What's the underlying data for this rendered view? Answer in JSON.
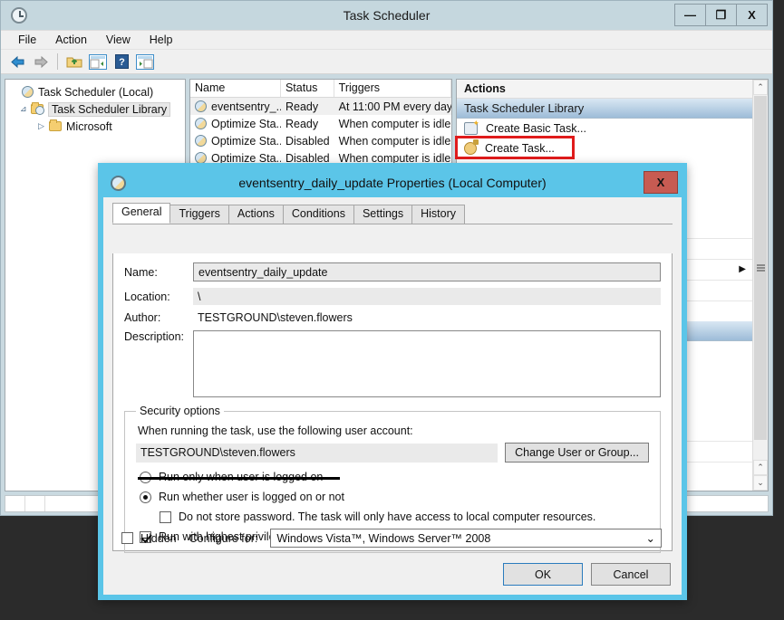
{
  "window": {
    "title": "Task Scheduler",
    "app_icon": "clock-icon",
    "controls": {
      "minimize": "—",
      "maximize": "❐",
      "close": "X"
    },
    "menu": [
      "File",
      "Action",
      "View",
      "Help"
    ],
    "toolbar": [
      {
        "name": "back-icon",
        "glyph": "⬅"
      },
      {
        "name": "forward-icon",
        "glyph": "➡"
      },
      {
        "name": "up-folder-icon",
        "glyph": "📂"
      },
      {
        "name": "show-tree-pane-icon",
        "glyph": "▤"
      },
      {
        "name": "help-icon",
        "glyph": "?"
      },
      {
        "name": "show-action-pane-icon",
        "glyph": "▥"
      }
    ]
  },
  "tree": {
    "root": "Task Scheduler (Local)",
    "library": "Task Scheduler Library",
    "microsoft": "Microsoft",
    "expander_open": "⊿",
    "expander_closed": "▷"
  },
  "tasklist": {
    "columns": [
      "Name",
      "Status",
      "Triggers"
    ],
    "rows": [
      {
        "name": "eventsentry_...",
        "status": "Ready",
        "triggers": "At 11:00 PM every day",
        "selected": true
      },
      {
        "name": "Optimize Sta...",
        "status": "Ready",
        "triggers": "When computer is idle",
        "selected": false
      },
      {
        "name": "Optimize Sta...",
        "status": "Disabled",
        "triggers": "When computer is idle",
        "selected": false
      },
      {
        "name": "Optimize Sta...",
        "status": "Disabled",
        "triggers": "When computer is idle",
        "selected": false
      }
    ]
  },
  "actions": {
    "header": "Actions",
    "group_title": "Task Scheduler Library",
    "items": [
      {
        "label": "Create Basic Task...",
        "icon": "create-basic-task-icon"
      },
      {
        "label": "Create Task...",
        "icon": "create-task-icon",
        "highlighted": true
      }
    ],
    "collapse_caret": "▲"
  },
  "dialog": {
    "title": "eventsentry_daily_update Properties (Local Computer)",
    "close_label": "X",
    "titlebar_color": "#5bc5e8",
    "tabs": [
      {
        "label": "General",
        "active": true
      },
      {
        "label": "Triggers",
        "active": false
      },
      {
        "label": "Actions",
        "active": false
      },
      {
        "label": "Conditions",
        "active": false
      },
      {
        "label": "Settings",
        "active": false
      },
      {
        "label": "History",
        "active": false
      }
    ],
    "fields": {
      "name_label": "Name:",
      "name_value": "eventsentry_daily_update",
      "location_label": "Location:",
      "location_value": "\\",
      "author_label": "Author:",
      "author_value": "TESTGROUND\\steven.flowers",
      "description_label": "Description:",
      "description_value": ""
    },
    "security": {
      "legend": "Security options",
      "account_prompt": "When running the task, use the following user account:",
      "account_value": "TESTGROUND\\steven.flowers",
      "change_button": "Change User or Group...",
      "radio_logged_on": "Run only when user is logged on",
      "radio_logged_on_selected": false,
      "radio_whether": "Run whether user is logged on or not",
      "radio_whether_selected": true,
      "checkbox_no_password": "Do not store password.  The task will only have access to local computer resources.",
      "checkbox_no_password_checked": false,
      "checkbox_highest": "Run with highest privileges",
      "checkbox_highest_checked": true
    },
    "footer": {
      "hidden_label": "Hidden",
      "hidden_checked": false,
      "configure_label": "Configure for:",
      "configure_value": "Windows Vista™, Windows Server™ 2008",
      "dropdown_caret": "⌄",
      "ok_button": "OK",
      "cancel_button": "Cancel"
    }
  },
  "annotations": {
    "red_box_target": "Create Task...",
    "red_box_color": "#e01b1b",
    "underline_target": "Run whether user is logged on or not",
    "underline_color": "#000000"
  }
}
